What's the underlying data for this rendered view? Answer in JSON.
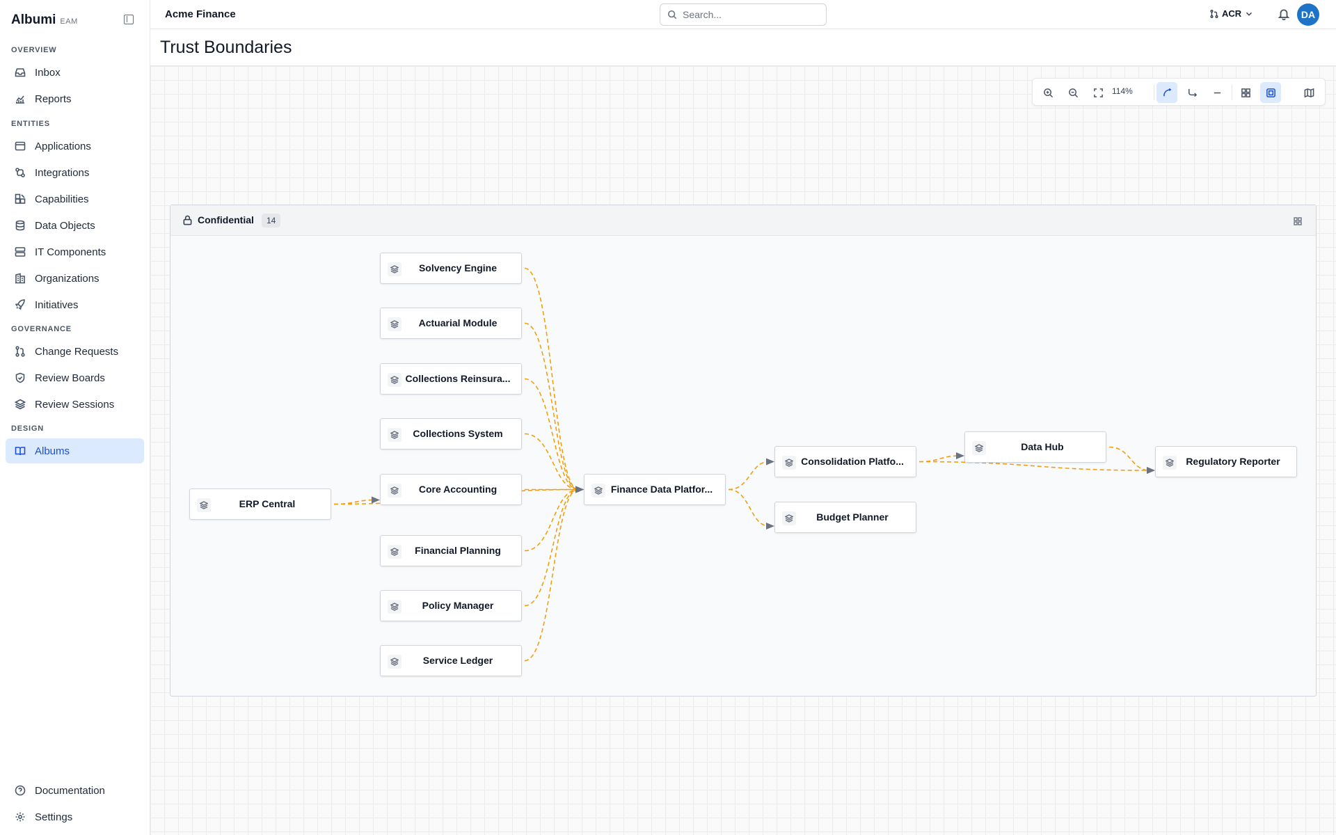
{
  "app": {
    "name": "Albumi",
    "edition": "EAM"
  },
  "topbar": {
    "workspace": "Acme Finance",
    "search_placeholder": "Search...",
    "user_menu": "ACR",
    "avatar_initials": "DA"
  },
  "sidebar": {
    "sections": [
      {
        "label": "OVERVIEW",
        "items": [
          {
            "label": "Inbox",
            "icon": "inbox-icon"
          },
          {
            "label": "Reports",
            "icon": "chart-icon"
          }
        ]
      },
      {
        "label": "ENTITIES",
        "items": [
          {
            "label": "Applications",
            "icon": "window-icon"
          },
          {
            "label": "Integrations",
            "icon": "integration-icon"
          },
          {
            "label": "Capabilities",
            "icon": "blocks-icon"
          },
          {
            "label": "Data Objects",
            "icon": "database-icon"
          },
          {
            "label": "IT Components",
            "icon": "server-icon"
          },
          {
            "label": "Organizations",
            "icon": "building-icon"
          },
          {
            "label": "Initiatives",
            "icon": "rocket-icon"
          }
        ]
      },
      {
        "label": "GOVERNANCE",
        "items": [
          {
            "label": "Change Requests",
            "icon": "git-pull-icon"
          },
          {
            "label": "Review Boards",
            "icon": "shield-icon"
          },
          {
            "label": "Review Sessions",
            "icon": "layers-icon"
          }
        ]
      },
      {
        "label": "DESIGN",
        "items": [
          {
            "label": "Albums",
            "icon": "book-icon",
            "active": true
          }
        ]
      }
    ],
    "footer": [
      {
        "label": "Documentation",
        "icon": "help-icon"
      },
      {
        "label": "Settings",
        "icon": "gear-icon"
      }
    ]
  },
  "page": {
    "title": "Trust Boundaries"
  },
  "toolbar": {
    "zoom": "114%",
    "buttons": [
      "zoom-in-icon",
      "zoom-out-icon",
      "fit-view-icon",
      "curved-edge-icon",
      "step-edge-icon",
      "straight-edge-icon",
      "grid-layout-icon",
      "group-layout-icon",
      "minimap-icon"
    ],
    "active": [
      "curved-edge-icon",
      "group-layout-icon"
    ]
  },
  "boundary": {
    "title": "Confidential",
    "count": "14",
    "nodes": [
      {
        "id": "solvency",
        "label": "Solvency Engine"
      },
      {
        "id": "actuarial",
        "label": "Actuarial Module"
      },
      {
        "id": "collre",
        "label": "Collections Reinsura..."
      },
      {
        "id": "collsys",
        "label": "Collections System"
      },
      {
        "id": "coreacc",
        "label": "Core Accounting"
      },
      {
        "id": "finplan",
        "label": "Financial Planning"
      },
      {
        "id": "policy",
        "label": "Policy Manager"
      },
      {
        "id": "ledger",
        "label": "Service Ledger"
      },
      {
        "id": "erp",
        "label": "ERP Central"
      },
      {
        "id": "fdp",
        "label": "Finance Data Platfor..."
      },
      {
        "id": "consol",
        "label": "Consolidation Platfo..."
      },
      {
        "id": "budget",
        "label": "Budget Planner"
      },
      {
        "id": "datahub",
        "label": "Data Hub"
      },
      {
        "id": "regrep",
        "label": "Regulatory Reporter"
      }
    ],
    "edge_color": "#f59e0b"
  }
}
